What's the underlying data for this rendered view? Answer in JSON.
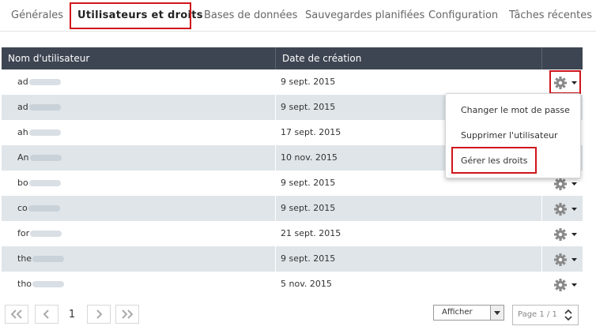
{
  "tabs": [
    {
      "label": "Générales"
    },
    {
      "label": "Utilisateurs et droits"
    },
    {
      "label": "Bases de données"
    },
    {
      "label": "Sauvegardes planifiées"
    },
    {
      "label": "Configuration"
    },
    {
      "label": "Tâches récentes"
    }
  ],
  "active_tab": "Utilisateurs et droits",
  "table": {
    "headers": {
      "username": "Nom d'utilisateur",
      "created": "Date de création"
    },
    "rows": [
      {
        "user": "ad",
        "date": "9 sept. 2015"
      },
      {
        "user": "ad",
        "date": "9 sept. 2015"
      },
      {
        "user": "ah",
        "date": "17 sept. 2015"
      },
      {
        "user": "An",
        "date": "10 nov. 2015"
      },
      {
        "user": "bo",
        "date": "9 sept. 2015"
      },
      {
        "user": "co",
        "date": "9 sept. 2015"
      },
      {
        "user": "for",
        "date": "21 sept. 2015"
      },
      {
        "user": "the",
        "date": "9 sept. 2015"
      },
      {
        "user": "tho",
        "date": "5 nov. 2015"
      }
    ]
  },
  "menu": {
    "items": [
      {
        "label": "Changer le mot de passe"
      },
      {
        "label": "Supprimer l'utilisateur"
      },
      {
        "label": "Gérer les droits"
      }
    ]
  },
  "pager": {
    "current_page": "1",
    "show_label": "Afficher",
    "page_indicator": "Page 1 / 1"
  },
  "colors": {
    "header_bg": "#3e4552",
    "row_alt_bg": "#dfe5e9",
    "highlight": "#d0151b"
  },
  "icons": {
    "row_action": "gear-icon",
    "first": "double-chevron-left-icon",
    "prev": "chevron-left-icon",
    "next": "chevron-right-icon",
    "last": "double-chevron-right-icon"
  }
}
